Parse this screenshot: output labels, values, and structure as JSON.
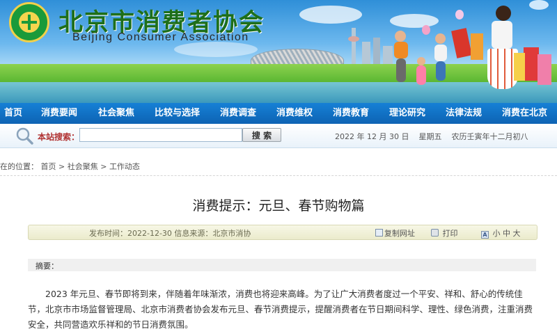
{
  "site": {
    "title": "北京市消费者协会",
    "subtitle": "Beijing Consumer Association"
  },
  "nav": {
    "items": [
      {
        "label": "首页"
      },
      {
        "label": "消费要闻"
      },
      {
        "label": "社会聚焦"
      },
      {
        "label": "比较与选择"
      },
      {
        "label": "消费调查"
      },
      {
        "label": "消费维权"
      },
      {
        "label": "消费教育"
      },
      {
        "label": "理论研究"
      },
      {
        "label": "法律法规"
      },
      {
        "label": "消费在北京"
      }
    ]
  },
  "search": {
    "label": "本站搜索：",
    "value": "",
    "button": "搜 索"
  },
  "date": {
    "gregorian": "2022 年 12 月 30 日",
    "weekday": "星期五",
    "lunar": "农历壬寅年十二月初八"
  },
  "breadcrumb": {
    "prefix": "在的位置：",
    "items": [
      "首页",
      "社会聚焦",
      "工作动态"
    ],
    "separator": ">"
  },
  "article": {
    "title": "消费提示：元旦、春节购物篇",
    "meta": "发布时间：2022-12-30  信息来源：北京市消协",
    "tools": {
      "copy": "复制网址",
      "print": "打印",
      "font_small": "小",
      "font_medium": "中",
      "font_large": "大"
    },
    "abstract_label": "摘要：",
    "body": "2023 年元旦、春节即将到来，伴随着年味渐浓，消费也将迎来高峰。为了让广大消费者度过一个平安、祥和、舒心的传统佳节，北京市市场监督管理局、北京市消费者协会发布元旦、春节消费提示，提醒消费者在节日期间科学、理性、绿色消费，注重消费安全，共同营造欢乐祥和的节日消费氛围。"
  },
  "colors": {
    "nav_bg": "#0d63b3",
    "title_green": "#1e6f1a",
    "search_label": "#b03030"
  }
}
